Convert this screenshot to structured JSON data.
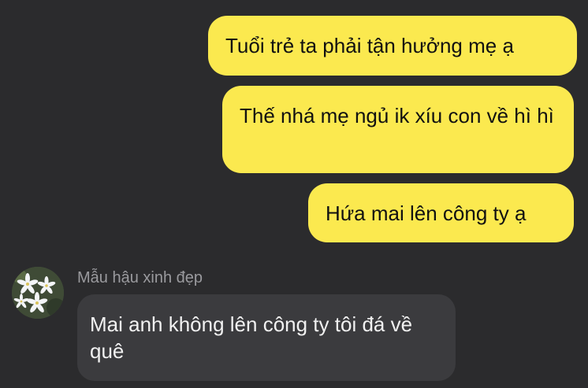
{
  "conversation": {
    "outgoing": [
      {
        "text": "Tuổi trẻ ta phải tận hưởng mẹ ạ"
      },
      {
        "text": "Thế nhá mẹ ngủ ik xíu con về hì hì"
      },
      {
        "text": "Hứa mai lên công ty ạ"
      }
    ],
    "incoming": {
      "sender_name": "Mẫu hậu xinh đẹp",
      "avatar_icon": "flower-avatar",
      "text": "Mai anh không lên công ty tôi đá về quê"
    }
  },
  "colors": {
    "background": "#2b2b2d",
    "outgoing_bubble": "#fbe94f",
    "incoming_bubble": "#3b3b3e",
    "sender_name": "#9a9a9e"
  }
}
